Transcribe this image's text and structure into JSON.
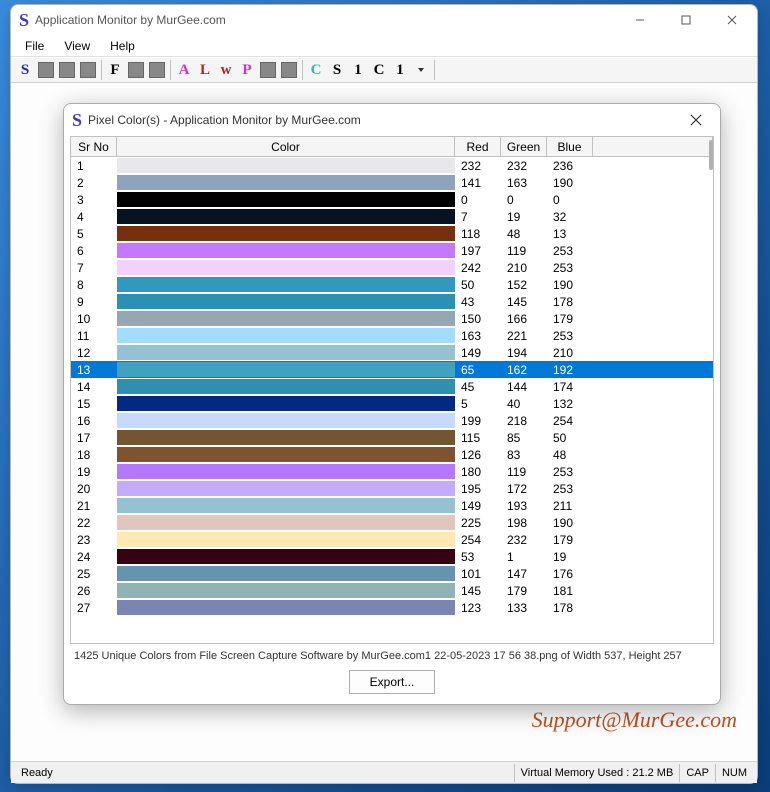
{
  "main": {
    "title": "Application Monitor by MurGee.com",
    "menu": {
      "file": "File",
      "view": "View",
      "help": "Help"
    },
    "status": {
      "ready": "Ready",
      "mem": "Virtual Memory Used : 21.2 MB",
      "cap": "CAP",
      "num": "NUM"
    },
    "support": "Support@MurGee.com"
  },
  "toolbar": {
    "b1": "S",
    "b2": "F",
    "b3": "A",
    "b4": "L",
    "b5": "w",
    "b6": "P",
    "b7": "C",
    "b8": "S",
    "b9": "1",
    "b10": "C",
    "b11": "1"
  },
  "dialog": {
    "title": "Pixel Color(s) - Application Monitor by MurGee.com",
    "headers": {
      "sr": "Sr No",
      "color": "Color",
      "r": "Red",
      "g": "Green",
      "b": "Blue"
    },
    "status": "1425 Unique Colors from File Screen Capture Software by MurGee.com1 22-05-2023 17 56 38.png of Width 537, Height 257",
    "export": "Export...",
    "selected": 13,
    "rows": [
      {
        "sr": 1,
        "r": 232,
        "g": 232,
        "b": 236
      },
      {
        "sr": 2,
        "r": 141,
        "g": 163,
        "b": 190
      },
      {
        "sr": 3,
        "r": 0,
        "g": 0,
        "b": 0
      },
      {
        "sr": 4,
        "r": 7,
        "g": 19,
        "b": 32
      },
      {
        "sr": 5,
        "r": 118,
        "g": 48,
        "b": 13
      },
      {
        "sr": 6,
        "r": 197,
        "g": 119,
        "b": 253
      },
      {
        "sr": 7,
        "r": 242,
        "g": 210,
        "b": 253
      },
      {
        "sr": 8,
        "r": 50,
        "g": 152,
        "b": 190
      },
      {
        "sr": 9,
        "r": 43,
        "g": 145,
        "b": 178
      },
      {
        "sr": 10,
        "r": 150,
        "g": 166,
        "b": 179
      },
      {
        "sr": 11,
        "r": 163,
        "g": 221,
        "b": 253
      },
      {
        "sr": 12,
        "r": 149,
        "g": 194,
        "b": 210
      },
      {
        "sr": 13,
        "r": 65,
        "g": 162,
        "b": 192
      },
      {
        "sr": 14,
        "r": 45,
        "g": 144,
        "b": 174
      },
      {
        "sr": 15,
        "r": 5,
        "g": 40,
        "b": 132
      },
      {
        "sr": 16,
        "r": 199,
        "g": 218,
        "b": 254
      },
      {
        "sr": 17,
        "r": 115,
        "g": 85,
        "b": 50
      },
      {
        "sr": 18,
        "r": 126,
        "g": 83,
        "b": 48
      },
      {
        "sr": 19,
        "r": 180,
        "g": 119,
        "b": 253
      },
      {
        "sr": 20,
        "r": 195,
        "g": 172,
        "b": 253
      },
      {
        "sr": 21,
        "r": 149,
        "g": 193,
        "b": 211
      },
      {
        "sr": 22,
        "r": 225,
        "g": 198,
        "b": 190
      },
      {
        "sr": 23,
        "r": 254,
        "g": 232,
        "b": 179
      },
      {
        "sr": 24,
        "r": 53,
        "g": 1,
        "b": 19
      },
      {
        "sr": 25,
        "r": 101,
        "g": 147,
        "b": 176
      },
      {
        "sr": 26,
        "r": 145,
        "g": 179,
        "b": 181
      },
      {
        "sr": 27,
        "r": 123,
        "g": 133,
        "b": 178
      }
    ]
  }
}
